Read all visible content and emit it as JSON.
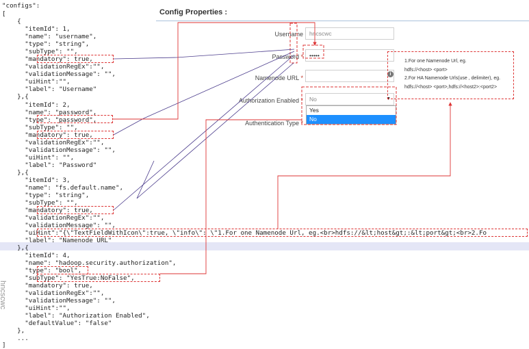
{
  "code": {
    "lines": [
      "\"configs\":",
      "[",
      "    {",
      "      \"itemId\": 1,",
      "      \"name\": \"username\",",
      "      \"type\": \"string\",",
      "      \"subType\": \"\",",
      "      \"mandatory\": true,",
      "      \"validationRegEx\":\"\",",
      "      \"validationMessage\": \"\",",
      "      \"uiHint\":\"\",",
      "      \"label\": \"Username\"",
      "    },{",
      "      \"itemId\": 2,",
      "      \"name\": \"password\",",
      "      \"type\": \"password\",",
      "      \"subType\": \"\",",
      "      \"mandatory\": true,",
      "      \"validationRegEx\":\"\",",
      "      \"validationMessage\": \"\",",
      "      \"uiHint\": \"\",",
      "      \"label\": \"Password\"",
      "    },{",
      "      \"itemId\": 3,",
      "      \"name\": \"fs.default.name\",",
      "      \"type\": \"string\",",
      "      \"subType\": \"\",",
      "      \"mandatory\": true,",
      "      \"validationRegEx\":\"\",",
      "      \"validationMessage\": \"\",",
      "      \"uiHint\":\"{\\\"TextFieldWithIcon\\\":true, \\\"info\\\": \\\"1.For one Namenode Url, eg.<br>hdfs://&lt;host&gt;:&lt;port&gt;<br>2.Fo",
      "      \"label\": \"Namenode URL\"",
      "    },{",
      "      \"itemId\": 4,",
      "      \"name\": \"hadoop.security.authorization\",",
      "      \"type\": \"bool\",",
      "      \"subType\": \"YesTrue:NoFalse\",",
      "      \"mandatory\": true,",
      "      \"validationRegEx\":\"\",",
      "      \"validationMessage\": \"\",",
      "      \"uiHint\":\"\",",
      "      \"label\": \"Authorization Enabled\",",
      "      \"defaultValue\": \"false\"",
      "    },",
      "    ...",
      "]"
    ],
    "watermark": "hncscwc"
  },
  "form": {
    "title": "Config Properties :",
    "required_mark": "*",
    "fields": [
      {
        "label": "Username",
        "value": "hncscwc"
      },
      {
        "label": "Password",
        "value": "•••••"
      },
      {
        "label": "Namenode URL",
        "value": ""
      },
      {
        "label": "Authorization Enabled",
        "value": "No"
      },
      {
        "label": "Authentication Type",
        "value": ""
      }
    ],
    "info_icon": "info-icon",
    "dropdown_options": [
      "Yes",
      "No"
    ],
    "dropdown_selected": "No"
  },
  "tooltip": {
    "lines": [
      "1.For one Namenode Url, eg.",
      "hdfs://<host> <port>",
      "2.For HA Namenode Urls(use , delimiter), eg.",
      "hdfs://<host> <port>,hdfs://<host2>:<port2>"
    ]
  },
  "colors": {
    "annotation": "#d33333",
    "connector": "#4b3c8c",
    "selection": "#1e90ff"
  }
}
